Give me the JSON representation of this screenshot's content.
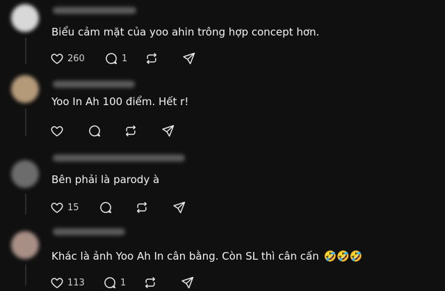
{
  "posts": [
    {
      "text": "Biểu cảm mặt của yoo ahin trông hợp concept hơn.",
      "likes": "260",
      "replies": "1",
      "avatar_color": "#d8d8d8"
    },
    {
      "text": "Yoo In Ah 100 điểm. Hết r!",
      "likes": "",
      "replies": "",
      "avatar_color": "#b59a7a"
    },
    {
      "text": "Bên phải là parody à",
      "likes": "15",
      "replies": "",
      "avatar_color": "#6c6c6c"
    },
    {
      "text": "Khác là ảnh Yoo Ah In cân bằng. Còn SL thì cân cấn",
      "emoji": "🤣🤣🤣",
      "likes": "113",
      "replies": "1",
      "avatar_color": "#a88f86"
    }
  ],
  "icons": [
    "heart-icon",
    "comment-icon",
    "repost-icon",
    "share-icon"
  ]
}
